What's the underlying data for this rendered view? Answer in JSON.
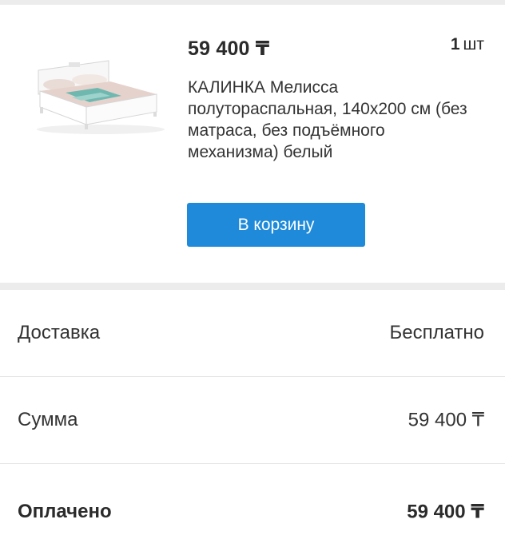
{
  "product": {
    "price": "59 400 ₸",
    "quantity_number": "1",
    "quantity_unit": "шт",
    "title": "КАЛИНКА Мелисса полутораспальная, 140x200 см (без матраса, без подъёмного механизма) белый",
    "cart_button_label": "В корзину",
    "image_icon": "bed-product-image"
  },
  "summary": {
    "delivery_label": "Доставка",
    "delivery_value": "Бесплатно",
    "sum_label": "Сумма",
    "sum_value": "59 400 ₸",
    "paid_label": "Оплачено",
    "paid_value": "59 400 ₸"
  },
  "colors": {
    "accent": "#1e8ad9",
    "separator": "#ececec"
  }
}
